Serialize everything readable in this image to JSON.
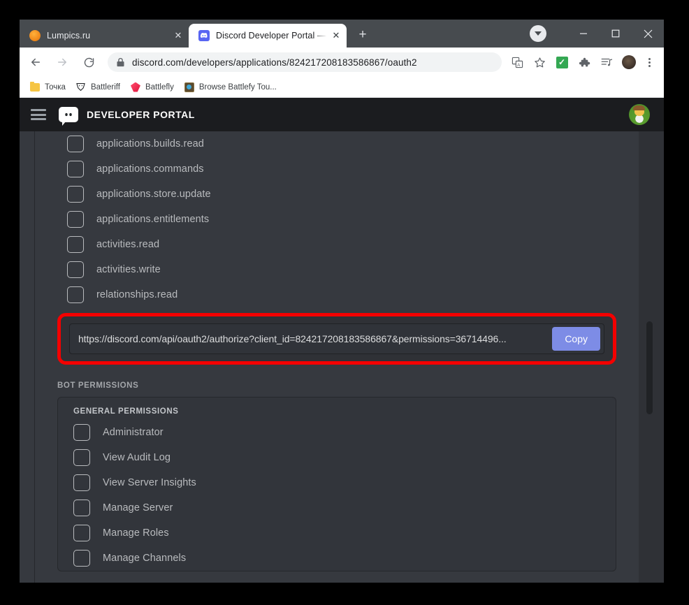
{
  "browser": {
    "tabs": [
      {
        "title": "Lumpics.ru",
        "favicon": "orange-circle-icon",
        "active": false,
        "close_label": "✕"
      },
      {
        "title": "Discord Developer Portal — My A",
        "favicon": "discord-icon",
        "active": true,
        "close_label": "✕"
      }
    ],
    "new_tab_label": "+",
    "window_controls": {
      "minimize": "minimize",
      "maximize": "maximize",
      "close": "close"
    },
    "omnibox": {
      "url": "discord.com/developers/applications/824217208183586867/oauth2",
      "lock_icon": "lock-icon"
    },
    "toolbar_icons": [
      "translate-icon",
      "bookmark-star-icon",
      "extension-check-icon",
      "extensions-puzzle-icon",
      "media-list-icon",
      "browser-profile-avatar",
      "chrome-menu-icon"
    ],
    "extension_check_glyph": "✓",
    "bookmarks": [
      {
        "label": "Точка",
        "icon": "folder-icon"
      },
      {
        "label": "Battleriff",
        "icon": "battleriff-icon"
      },
      {
        "label": "Battlefly",
        "icon": "battlefly-icon"
      },
      {
        "label": "Browse Battlefy Tou...",
        "icon": "battlefy-tournament-icon"
      }
    ]
  },
  "discord": {
    "header": {
      "menu_icon": "hamburger-menu-icon",
      "logo_icon": "discord-logo-icon",
      "title": "DEVELOPER PORTAL",
      "avatar_icon": "user-avatar"
    },
    "scopes": [
      "applications.builds.read",
      "applications.commands",
      "applications.store.update",
      "applications.entitlements",
      "activities.read",
      "activities.write",
      "relationships.read"
    ],
    "generated_url": {
      "value": "https://discord.com/api/oauth2/authorize?client_id=824217208183586867&permissions=36714496...",
      "copy_label": "Copy",
      "highlight_color": "#f40000",
      "copy_button_color": "#7d8ce6"
    },
    "bot_permissions": {
      "section_title": "BOT PERMISSIONS",
      "group_title": "GENERAL PERMISSIONS",
      "items": [
        "Administrator",
        "View Audit Log",
        "View Server Insights",
        "Manage Server",
        "Manage Roles",
        "Manage Channels"
      ]
    }
  }
}
